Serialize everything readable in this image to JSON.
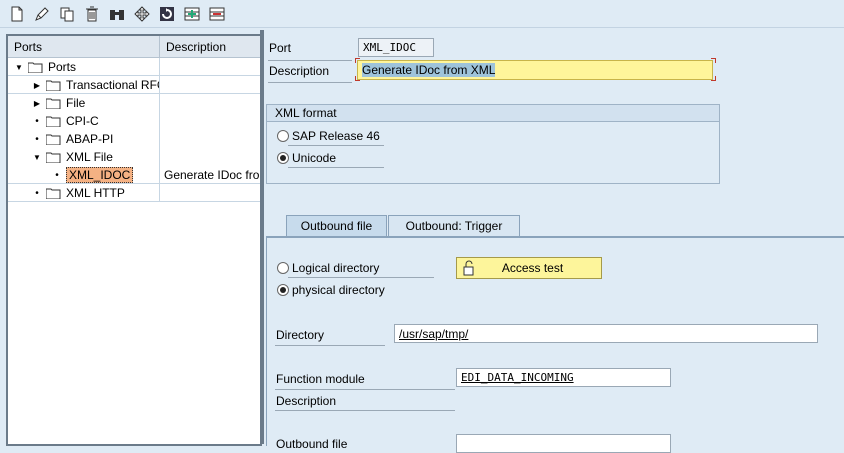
{
  "toolbar": {
    "icons": [
      "new-icon",
      "edit-icon",
      "copy-icon",
      "delete-icon",
      "binoculars-icon",
      "move-icon",
      "refresh-icon",
      "add-row-icon",
      "remove-row-icon"
    ]
  },
  "tree": {
    "columns": {
      "ports": "Ports",
      "description": "Description"
    },
    "nodes": [
      {
        "label": "Ports",
        "description": ""
      },
      {
        "label": "Transactional RFC",
        "description": ""
      },
      {
        "label": "File",
        "description": ""
      },
      {
        "label": "CPI-C",
        "description": ""
      },
      {
        "label": "ABAP-PI",
        "description": ""
      },
      {
        "label": "XML File",
        "description": ""
      },
      {
        "label": "XML_IDOC",
        "description": "Generate IDoc from XML"
      },
      {
        "label": "XML HTTP",
        "description": ""
      }
    ]
  },
  "detail": {
    "port_label": "Port",
    "port_value": "XML_IDOC",
    "description_label": "Description",
    "description_value": "Generate IDoc from XML"
  },
  "xml_format": {
    "title": "XML format",
    "options": [
      "SAP Release 46",
      "Unicode"
    ],
    "selected": "Unicode"
  },
  "tabs": [
    {
      "label": "Outbound file",
      "active": true
    },
    {
      "label": "Outbound: Trigger",
      "active": false
    }
  ],
  "outbound": {
    "directory_options": [
      "Logical directory",
      "physical directory"
    ],
    "directory_selected": "physical directory",
    "access_test_label": "Access test",
    "directory_label": "Directory",
    "directory_value": "/usr/sap/tmp/",
    "function_module_label": "Function module",
    "function_module_value": "EDI_DATA_INCOMING",
    "description_label": "Description",
    "outbound_file_label": "Outbound file",
    "outbound_file_value": ""
  },
  "colors": {
    "background": "#dfebf5",
    "selected_node": "#f4b183",
    "required_field": "#fff59b"
  }
}
